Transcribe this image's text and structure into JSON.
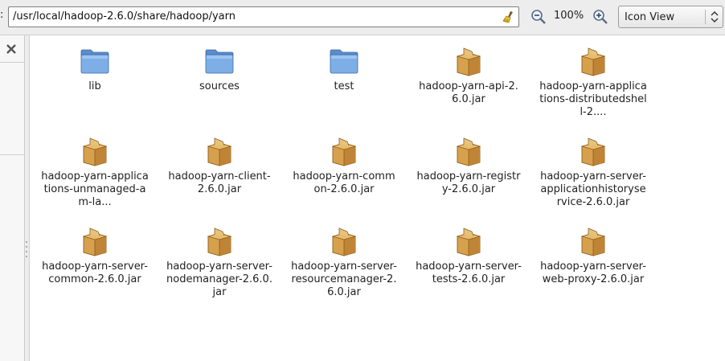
{
  "toolbar": {
    "location_prefix": ":",
    "location_path": "/usr/local/hadoop-2.6.0/share/hadoop/yarn",
    "zoom_level": "100%",
    "view_mode": "Icon View"
  },
  "icons": {
    "clear": "broom-icon",
    "zoom_out": "zoom-out-icon",
    "zoom_in": "zoom-in-icon",
    "close": "close-icon",
    "folder": "folder-icon",
    "jar": "package-icon"
  },
  "colors": {
    "folder": "#6f9fd8",
    "jar": "#c8963e"
  },
  "files": [
    {
      "name": "lib",
      "type": "folder"
    },
    {
      "name": "sources",
      "type": "folder"
    },
    {
      "name": "test",
      "type": "folder"
    },
    {
      "name": "hadoop-yarn-api-2.6.0.jar",
      "type": "jar"
    },
    {
      "name": "hadoop-yarn-applications-distributedshell-2....",
      "type": "jar"
    },
    {
      "name": "hadoop-yarn-applications-unmanaged-am-la...",
      "type": "jar"
    },
    {
      "name": "hadoop-yarn-client-2.6.0.jar",
      "type": "jar"
    },
    {
      "name": "hadoop-yarn-common-2.6.0.jar",
      "type": "jar"
    },
    {
      "name": "hadoop-yarn-registry-2.6.0.jar",
      "type": "jar"
    },
    {
      "name": "hadoop-yarn-server-applicationhistoryservice-2.6.0.jar",
      "type": "jar"
    },
    {
      "name": "hadoop-yarn-server-common-2.6.0.jar",
      "type": "jar"
    },
    {
      "name": "hadoop-yarn-server-nodemanager-2.6.0.jar",
      "type": "jar"
    },
    {
      "name": "hadoop-yarn-server-resourcemanager-2.6.0.jar",
      "type": "jar"
    },
    {
      "name": "hadoop-yarn-server-tests-2.6.0.jar",
      "type": "jar"
    },
    {
      "name": "hadoop-yarn-server-web-proxy-2.6.0.jar",
      "type": "jar"
    }
  ]
}
